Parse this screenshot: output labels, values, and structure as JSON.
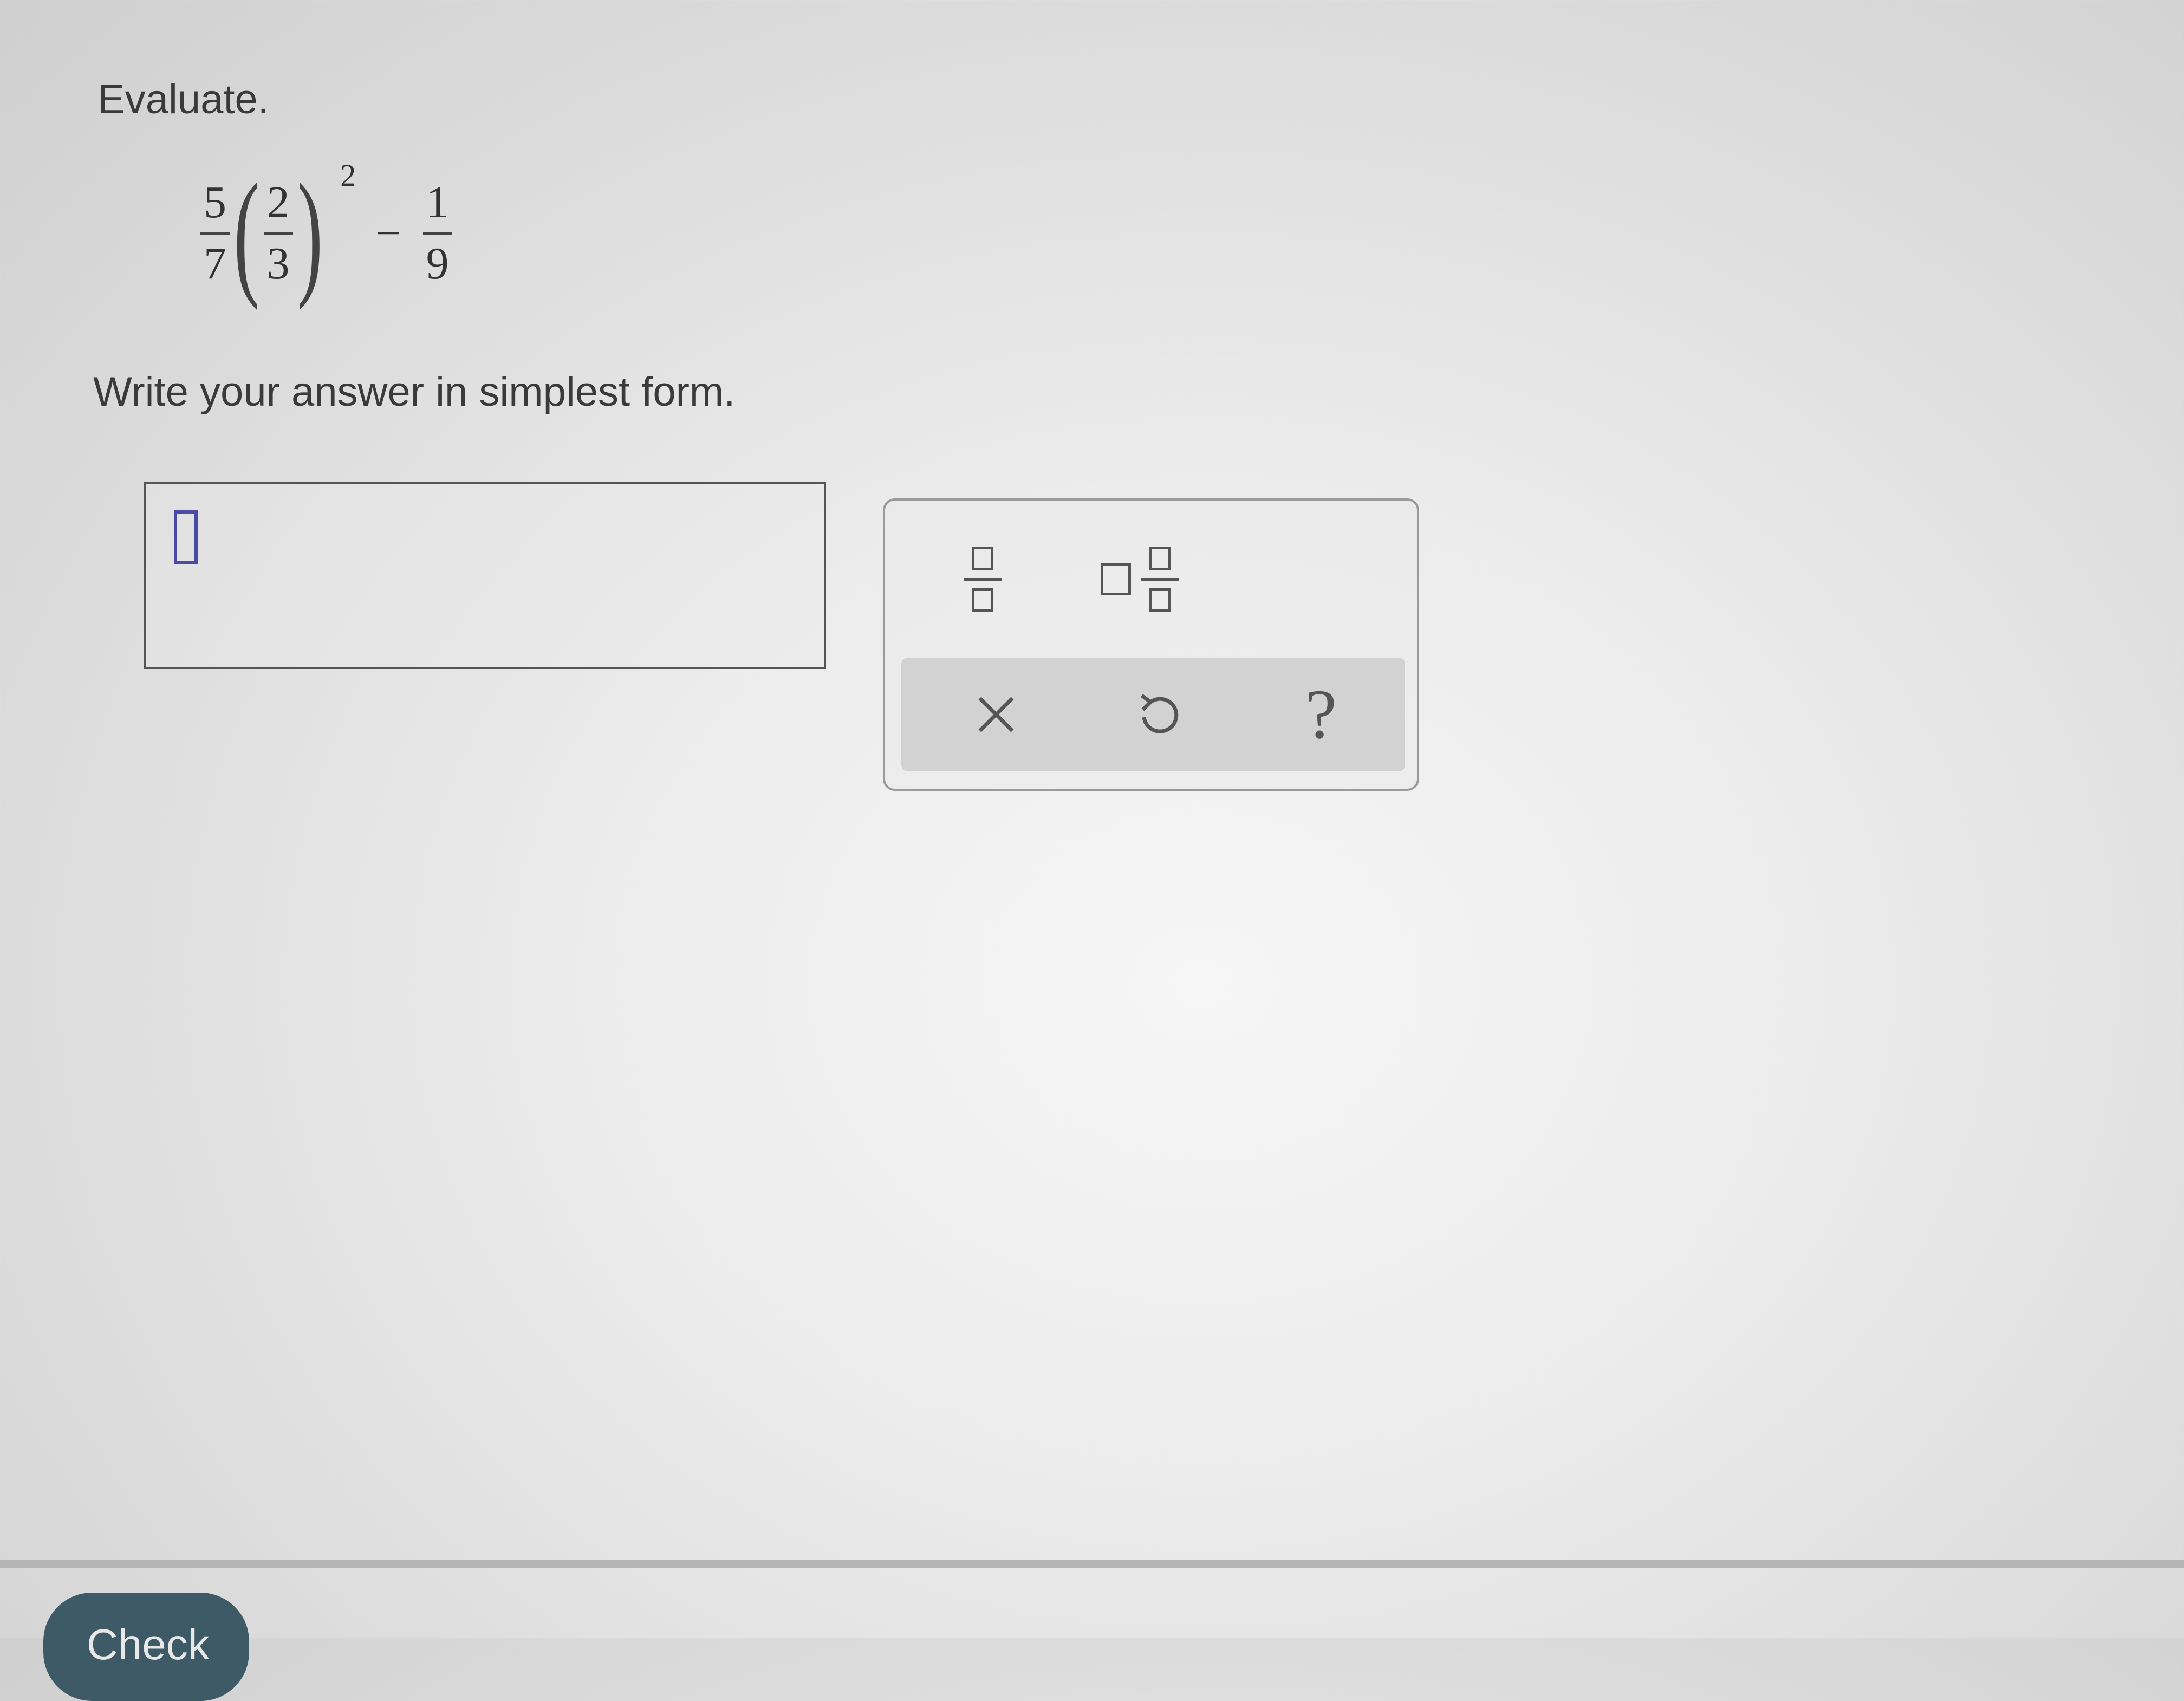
{
  "question": {
    "instruction": "Evaluate.",
    "expression": {
      "first_fraction": {
        "numerator": "5",
        "denominator": "7"
      },
      "inner_fraction": {
        "numerator": "2",
        "denominator": "3"
      },
      "exponent": "2",
      "operator": "−",
      "second_fraction": {
        "numerator": "1",
        "denominator": "9"
      }
    },
    "subinstruction": "Write your answer in simplest form."
  },
  "answer": {
    "value": ""
  },
  "palette": {
    "buttons": [
      {
        "name": "fraction",
        "icon": "fraction-icon"
      },
      {
        "name": "mixed-number",
        "icon": "mixed-number-icon"
      }
    ],
    "actions": {
      "clear": "×",
      "undo": "↺",
      "help": "?"
    }
  },
  "footer": {
    "check_label": "Check"
  }
}
